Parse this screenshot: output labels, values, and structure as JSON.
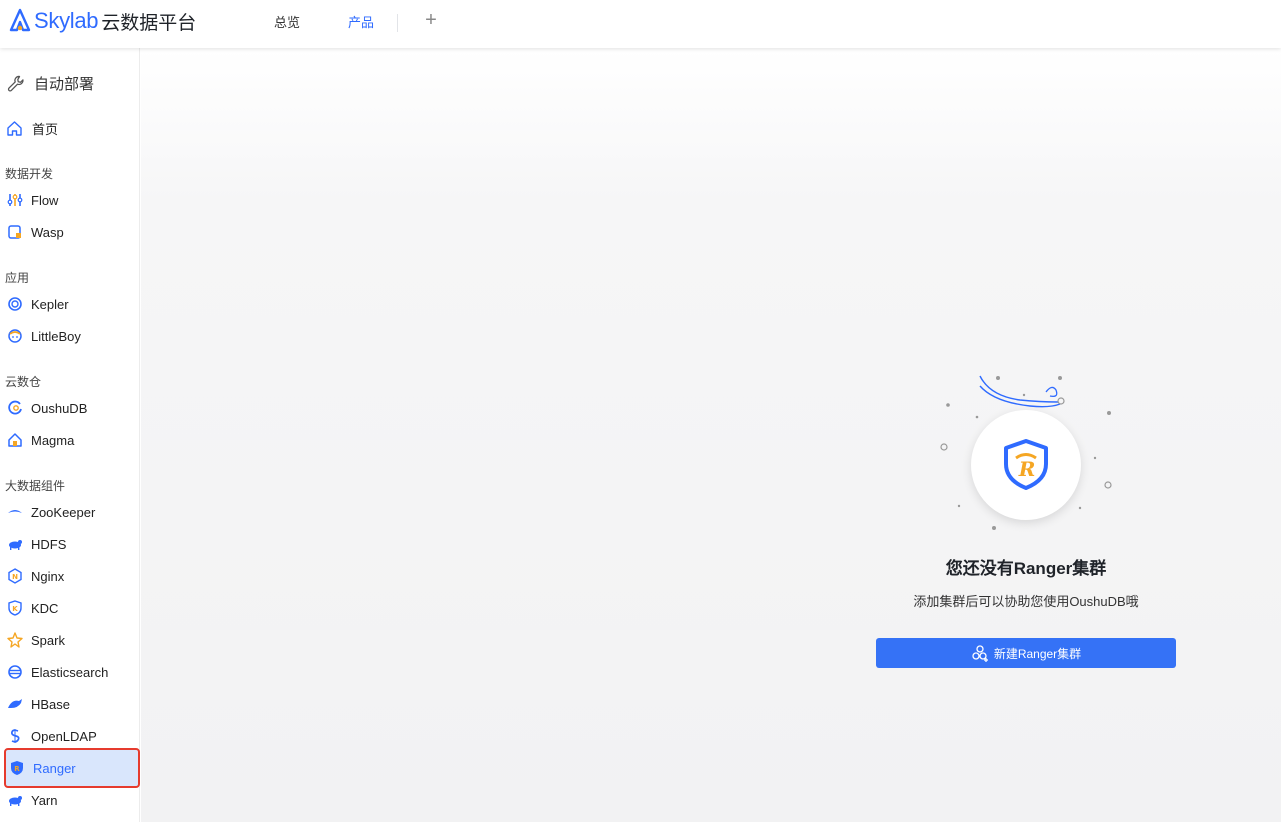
{
  "header": {
    "brand_name": "Skylab",
    "brand_suffix": "云数据平台",
    "tabs": [
      {
        "label": "总览",
        "active": false
      },
      {
        "label": "产品",
        "active": true
      }
    ],
    "add_icon": "plus-icon",
    "accent_color": "#2f6bff"
  },
  "sidebar": {
    "deploy_label": "自动部署",
    "home_label": "首页",
    "groups": [
      {
        "title": "数据开发",
        "items": [
          {
            "label": "Flow",
            "icon": "flow-icon"
          },
          {
            "label": "Wasp",
            "icon": "wasp-icon"
          }
        ]
      },
      {
        "title": "应用",
        "items": [
          {
            "label": "Kepler",
            "icon": "kepler-icon"
          },
          {
            "label": "LittleBoy",
            "icon": "littleboy-icon"
          }
        ]
      },
      {
        "title": "云数仓",
        "items": [
          {
            "label": "OushuDB",
            "icon": "oushudb-icon"
          },
          {
            "label": "Magma",
            "icon": "magma-icon"
          }
        ]
      },
      {
        "title": "大数据组件",
        "items": [
          {
            "label": "ZooKeeper",
            "icon": "zookeeper-icon"
          },
          {
            "label": "HDFS",
            "icon": "hdfs-icon"
          },
          {
            "label": "Nginx",
            "icon": "nginx-icon"
          },
          {
            "label": "KDC",
            "icon": "kdc-icon"
          },
          {
            "label": "Spark",
            "icon": "spark-icon"
          },
          {
            "label": "Elasticsearch",
            "icon": "elasticsearch-icon"
          },
          {
            "label": "HBase",
            "icon": "hbase-icon"
          },
          {
            "label": "OpenLDAP",
            "icon": "openldap-icon"
          },
          {
            "label": "Ranger",
            "icon": "ranger-icon",
            "selected": true
          },
          {
            "label": "Yarn",
            "icon": "yarn-icon"
          }
        ]
      }
    ],
    "selected_highlight_color": "#e63b2e"
  },
  "empty_state": {
    "title": "您还没有Ranger集群",
    "description": "添加集群后可以协助您使用OushuDB哦",
    "button_label": "新建Ranger集群",
    "button_color": "#3572f6"
  }
}
